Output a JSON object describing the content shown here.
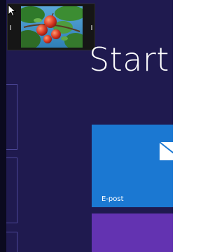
{
  "start": {
    "title": "Start"
  },
  "thumbnail": {
    "icon": "apple-tree-photo-thumbnail"
  },
  "tiles": [
    {
      "label": "E-post",
      "icon": "mail-icon",
      "color": "#1b78d2"
    },
    {
      "label": "",
      "icon": "",
      "color": "#6333b1"
    }
  ],
  "colors": {
    "background": "#1f1a4f",
    "accent": "#1b78d2"
  }
}
